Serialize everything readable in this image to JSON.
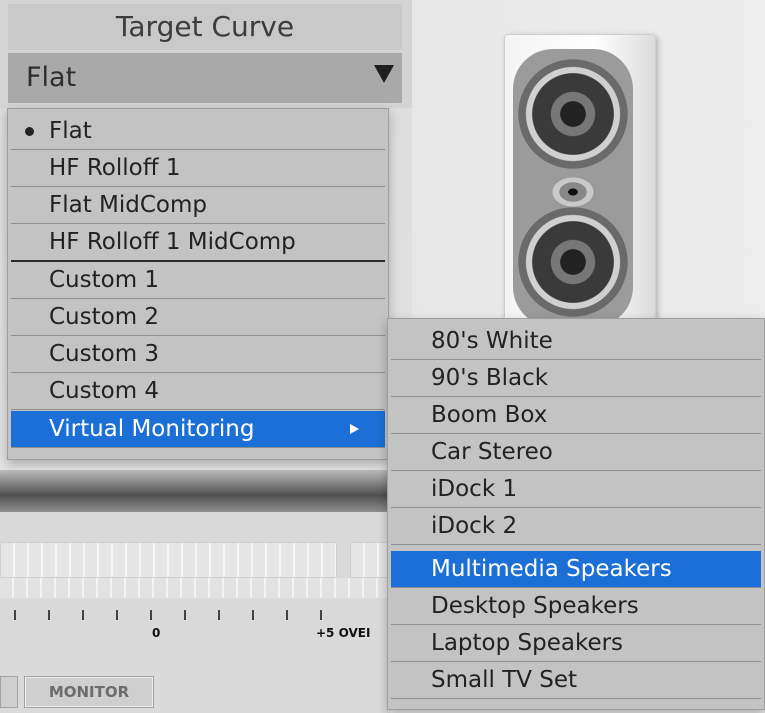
{
  "header": {
    "title": "Target Curve",
    "selected_value": "Flat"
  },
  "menu": {
    "items": [
      {
        "label": "Flat",
        "checked": true
      },
      {
        "label": "HF Rolloff 1"
      },
      {
        "label": "Flat MidComp"
      },
      {
        "label": "HF Rolloff 1 MidComp"
      },
      {
        "label": "Custom 1"
      },
      {
        "label": "Custom 2"
      },
      {
        "label": "Custom 3"
      },
      {
        "label": "Custom 4"
      },
      {
        "label": "Virtual Monitoring",
        "selected": true,
        "has_submenu": true
      }
    ]
  },
  "submenu": {
    "items": [
      {
        "label": "80's White"
      },
      {
        "label": "90's Black"
      },
      {
        "label": "Boom Box"
      },
      {
        "label": "Car Stereo"
      },
      {
        "label": "iDock 1"
      },
      {
        "label": "iDock 2"
      },
      {
        "label": "Multimedia Speakers",
        "selected": true
      },
      {
        "label": "Desktop Speakers"
      },
      {
        "label": "Laptop Speakers"
      },
      {
        "label": "Small TV Set"
      }
    ]
  },
  "meter": {
    "label_zero": "0",
    "label_plus5": "+5 OVEI"
  },
  "buttons": {
    "monitor_label": "MONITOR"
  },
  "colors": {
    "selection": "#1c6fd6",
    "menu_bg": "#c3c3c3"
  }
}
